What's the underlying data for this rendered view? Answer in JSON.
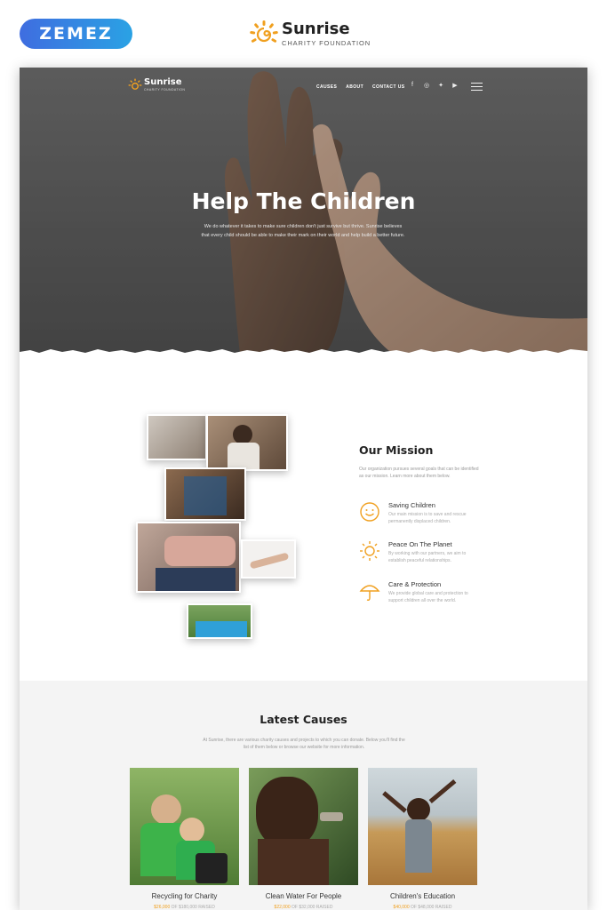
{
  "topbar": {
    "badge_label": "ZEMEZ",
    "brand_name": "Sunrise",
    "brand_tagline": "CHARITY FOUNDATION",
    "sun_icon": "sun-logo-icon",
    "accent_color": "#f0a020"
  },
  "site": {
    "logo_name": "Sunrise",
    "logo_tagline": "CHARITY FOUNDATION",
    "nav": [
      "CAUSES",
      "ABOUT",
      "CONTACT US"
    ],
    "social_icons": [
      "facebook-icon",
      "instagram-icon",
      "twitter-icon",
      "youtube-icon"
    ],
    "menu_icon": "hamburger-menu-icon"
  },
  "hero": {
    "title": "Help The Children",
    "text": "We do whatever it takes to make sure children don't just survive but thrive. Sunrise believes that every child should be able to make their mark on their world and help build a better future."
  },
  "mission": {
    "title": "Our Mission",
    "intro": "Our organization pursues several goals that can be identified as our mission. Learn more about them below.",
    "features": [
      {
        "icon": "smile-icon",
        "title": "Saving Children",
        "text": "Our main mission is to save and rescue permanently displaced children."
      },
      {
        "icon": "sun-icon",
        "title": "Peace On The Planet",
        "text": "By working with our partners, we aim to establish peaceful relationships."
      },
      {
        "icon": "umbrella-icon",
        "title": "Care & Protection",
        "text": "We provide global care and protection to support children all over the world."
      }
    ]
  },
  "causes": {
    "title": "Latest Causes",
    "intro": "At Sunrise, there are various charity causes and projects to which you can donate. Below you'll find the list of them below or browse our website for more information.",
    "items": [
      {
        "name": "Recycling for Charity",
        "raised": "$26,000",
        "goal": "OF $180,000 RAISED"
      },
      {
        "name": "Clean Water For People",
        "raised": "$22,000",
        "goal": "OF $32,000 RAISED"
      },
      {
        "name": "Children's Education",
        "raised": "$40,000",
        "goal": "OF $48,000 RAISED"
      }
    ]
  }
}
